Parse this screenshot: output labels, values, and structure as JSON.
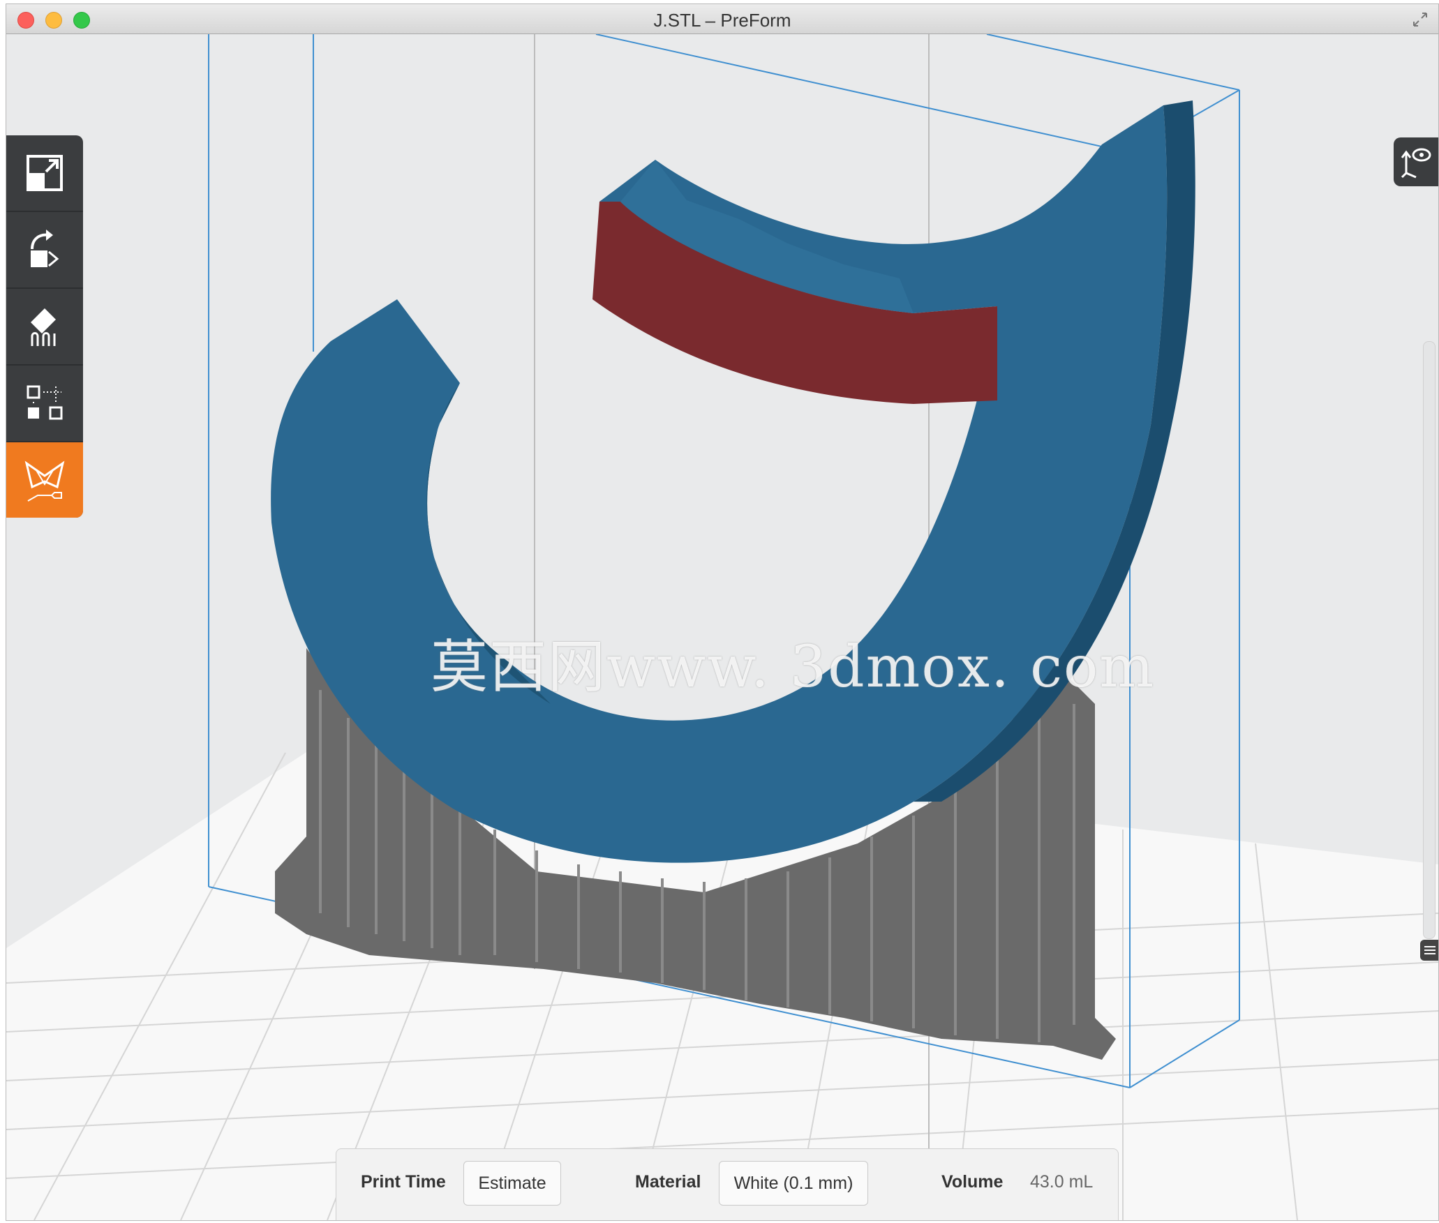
{
  "window": {
    "title": "J.STL – PreForm"
  },
  "toolbar": {
    "tools": [
      {
        "name": "scale"
      },
      {
        "name": "orientation"
      },
      {
        "name": "supports"
      },
      {
        "name": "layout"
      },
      {
        "name": "print",
        "active": true
      }
    ]
  },
  "watermark": "莫西网www. 3dmox. com",
  "bottom_bar": {
    "print_time_label": "Print Time",
    "estimate_button": "Estimate",
    "material_label": "Material",
    "material_value": "White (0.1 mm)",
    "volume_label": "Volume",
    "volume_value": "43.0 mL"
  },
  "colors": {
    "accent": "#f07a1f",
    "model": "#2b6b94",
    "overhang": "#7a2a2e",
    "supports": "#6a6a6a",
    "build_volume": "#3f8fd0"
  }
}
